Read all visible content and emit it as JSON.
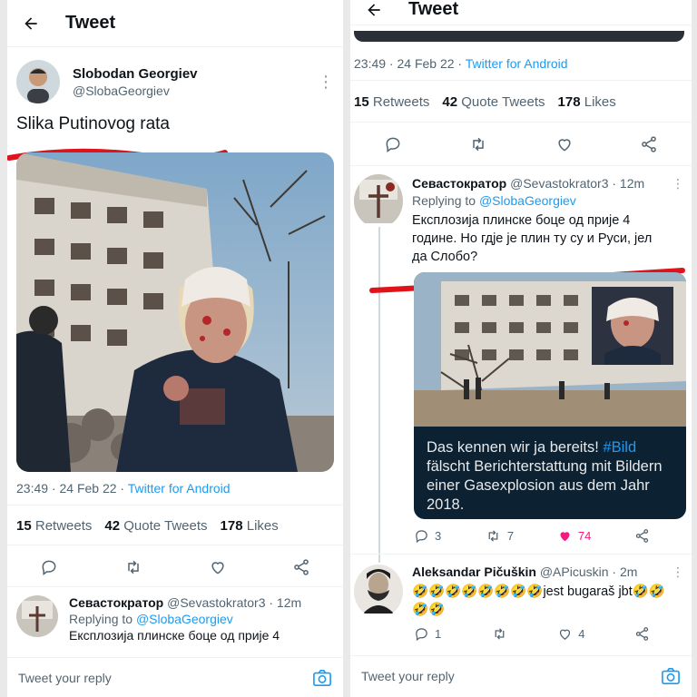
{
  "left": {
    "header": {
      "title": "Tweet"
    },
    "tweet": {
      "author_name": "Slobodan Georgiev",
      "handle": "@SlobaGeorgiev",
      "text": "Slika Putinovog rata",
      "meta_time": "23:49 · 24 Feb 22 ·",
      "meta_source": "Twitter for Android",
      "retweets": "15",
      "retweets_label": "Retweets",
      "quotes": "42",
      "quotes_label": "Quote Tweets",
      "likes": "178",
      "likes_label": "Likes"
    },
    "reply": {
      "author_name": "Севастократор",
      "handle": "@Sevastokrator3 · 12m",
      "replying_prefix": "Replying to",
      "replying_to": "@SlobaGeorgiev",
      "text_partial": "Експлозија плинске боце од прије 4"
    },
    "reply_bar": {
      "placeholder": "Tweet your reply"
    }
  },
  "right": {
    "header": {
      "title": "Tweet"
    },
    "meta_time": "23:49 · 24 Feb 22 ·",
    "meta_source": "Twitter for Android",
    "retweets": "15",
    "retweets_label": "Retweets",
    "quotes": "42",
    "quotes_label": "Quote Tweets",
    "likes": "178",
    "likes_label": "Likes",
    "reply1": {
      "author_name": "Севастократор",
      "handle": "@Sevastokrator3 · 12m",
      "replying_prefix": "Replying to",
      "replying_to": "@SlobaGeorgiev",
      "text": "Експлозија плинске боце од прије 4 године. Но гдје је плин ту су и Руси, јел да Слобо?",
      "embed_caption_pre": "Das kennen wir ja bereits!",
      "embed_caption_tag": "#Bild",
      "embed_caption_post": "fälscht Berichterstattung mit Bildern einer Gasexplosion aus dem Jahr 2018.",
      "replies": "3",
      "retweets": "7",
      "likes": "74"
    },
    "reply2": {
      "author_name": "Aleksandar Pičuškin",
      "handle": "@APicuskin · 2m",
      "emoji_run_1": "🤣🤣🤣🤣🤣🤣🤣🤣",
      "text_mid": "jest bugaraš jbt",
      "emoji_run_2": "🤣🤣",
      "emoji_run_3": "🤣🤣",
      "replies": "1",
      "likes": "4"
    },
    "reply_bar": {
      "placeholder": "Tweet your reply"
    }
  },
  "colors": {
    "accent": "#1d9bf0",
    "like": "#f91880",
    "annotation_red": "#e0121a",
    "embed_bg": "#0c2132"
  }
}
